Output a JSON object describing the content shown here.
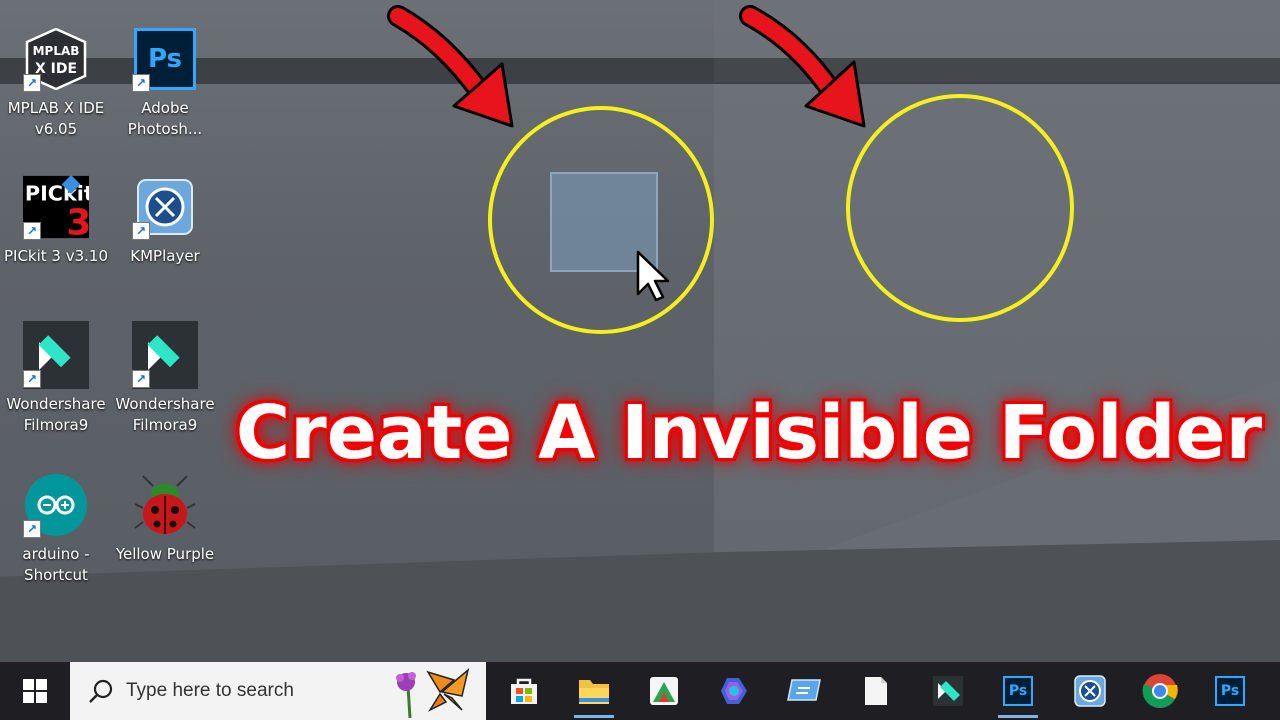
{
  "desktop": {
    "icons": [
      {
        "label": "MPLAB X IDE\nv6.05",
        "icon": "mplab-icon"
      },
      {
        "label": "Adobe\nPhotosh...",
        "icon": "photoshop-icon"
      },
      {
        "label": "PICkit 3 v3.10",
        "icon": "pickit-icon"
      },
      {
        "label": "KMPlayer",
        "icon": "kmplayer-icon"
      },
      {
        "label": "Wondershare\nFilmora9",
        "icon": "filmora-icon"
      },
      {
        "label": "Wondershare\nFilmora9",
        "icon": "filmora-icon"
      },
      {
        "label": "arduino -\nShortcut",
        "icon": "arduino-icon"
      },
      {
        "label": "Yellow Purple",
        "icon": "ladybug-icon"
      }
    ],
    "icon_texts": {
      "mplab_top": "MPLAB",
      "mplab_bottom": "X IDE",
      "ps": "Ps",
      "pickit_top": "PICkit",
      "pickit_num": "3"
    }
  },
  "overlay": {
    "headline": "Create A Invisible Folder",
    "arrow_color": "#e8141b",
    "circle_color": "#f5f01c"
  },
  "taskbar": {
    "search_placeholder": "Type here to search",
    "pinned": [
      "store-icon",
      "file-explorer-icon",
      "pinned-app-icon",
      "copilot-icon",
      "remote-desktop-icon",
      "notepad-icon",
      "filmora-icon",
      "photoshop-icon",
      "kmplayer-icon",
      "chrome-icon",
      "photoshop-icon"
    ],
    "ps_label": "Ps"
  }
}
